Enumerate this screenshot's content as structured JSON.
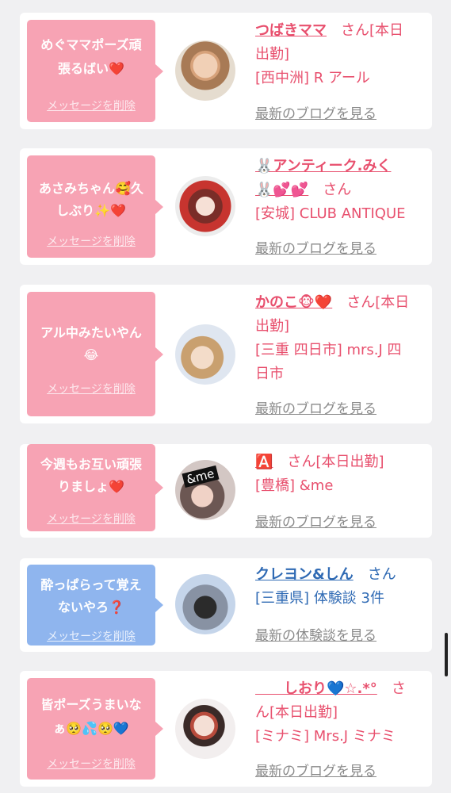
{
  "entries": [
    {
      "message_line1": "めぐママポーズ頑",
      "message_line2": "張るばい❤️",
      "delete_label": "メッセージを削除",
      "name": "つばきママ",
      "info_line1_suffix": "さん[本日",
      "info_line2": "出勤]",
      "info_line3": "[西中洲] R アール",
      "info_line4": "",
      "blog_link": "最新のブログを見る",
      "bubble_color": "#f7a3b4"
    },
    {
      "message_line1": "あさみちゃん🥰久",
      "message_line2": "しぶり✨❤️",
      "delete_label": "メッセージを削除",
      "name": "🐰アンティーク.みく",
      "info_line1_suffix": "",
      "info_line2_prefix": "🐰💕💕",
      "info_line2": "さん",
      "info_line3": "[安城] CLUB ANTIQUE",
      "info_line4": "",
      "blog_link": "最新のブログを見る",
      "bubble_color": "#f7a3b4"
    },
    {
      "message_line1": "アル中みたいやん",
      "message_line2": "😂",
      "delete_label": "メッセージを削除",
      "name": "かのこ🐵❤️",
      "info_line1_suffix": "さん[本日",
      "info_line2": "出勤]",
      "info_line3": "[三重 四日市] mrs.J 四",
      "info_line4": "日市",
      "blog_link": "最新のブログを見る",
      "bubble_color": "#f7a3b4"
    },
    {
      "message_line1": "今週もお互い頑張",
      "message_line2": "りましょ❤️",
      "delete_label": "メッセージを削除",
      "name": "🅰️",
      "info_line1_suffix": "さん[本日出勤]",
      "info_line2": "[豊橋] &me",
      "blog_link": "最新のブログを見る",
      "bubble_color": "#f7a3b4"
    },
    {
      "message_line1": "酔っぱらって覚え",
      "message_line2": "ないやろ❓",
      "delete_label": "メッセージを削除",
      "name": "クレヨン&しん",
      "info_line1_suffix": "さん",
      "info_line2": "[三重県] 体験談 3件",
      "blog_link": "最新の体験談を見る",
      "bubble_color": "#8fb5ee"
    },
    {
      "message_line1": "皆ポーズうまいな",
      "message_line2": "ぁ🥺💦🥺💙",
      "delete_label": "メッセージを削除",
      "name": "　　しおり💙☆.*°",
      "info_line1_suffix": "さ",
      "info_line2": "ん[本日出勤]",
      "info_line3": "[ミナミ] Mrs.J ミナミ",
      "blog_link": "最新のブログを見る",
      "bubble_color": "#f7a3b4"
    }
  ],
  "avatar_text": "&me"
}
